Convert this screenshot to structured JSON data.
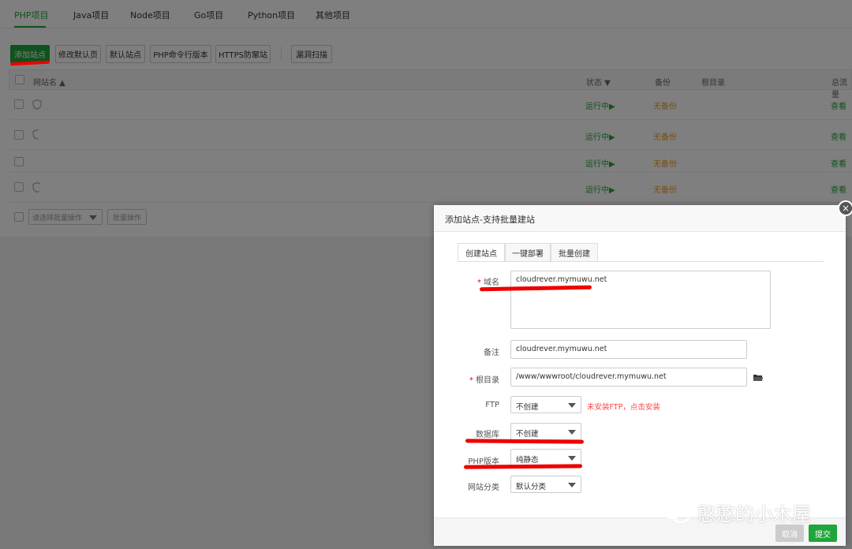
{
  "tabs": [
    "PHP项目",
    "Java项目",
    "Node项目",
    "Go项目",
    "Python项目",
    "其他项目"
  ],
  "toolbar": {
    "add_site": "添加站点",
    "modify_default_page": "修改默认页",
    "default_site": "默认站点",
    "php_cli_version": "PHP命令行版本",
    "https_protection": "HTTPS防窜站",
    "vuln_scan": "漏洞扫描"
  },
  "table": {
    "headers": {
      "site_name": "网站名",
      "status": "状态",
      "backup": "备份",
      "root": "根目录",
      "traffic": "总流量"
    },
    "rows": [
      {
        "status": "运行中▶",
        "backup": "无备份",
        "action": "查看"
      },
      {
        "status": "运行中▶",
        "backup": "无备份",
        "action": "查看"
      },
      {
        "status": "运行中▶",
        "backup": "无备份",
        "action": "查看"
      },
      {
        "status": "运行中▶",
        "backup": "无备份",
        "action": "查看"
      }
    ],
    "batch_placeholder": "请选择批量操作",
    "batch_button": "批量操作"
  },
  "dialog": {
    "title": "添加站点-支持批量建站",
    "close": "×",
    "tabs": [
      "创建站点",
      "一键部署",
      "批量创建"
    ],
    "labels": {
      "domain": "域名",
      "remark": "备注",
      "root": "根目录",
      "ftp": "FTP",
      "database": "数据库",
      "php_version": "PHP版本",
      "category": "网站分类"
    },
    "values": {
      "domain": "cloudrever.mymuwu.net",
      "remark": "cloudrever.mymuwu.net",
      "root": "/www/wwwroot/cloudrever.mymuwu.net",
      "ftp": "不创建",
      "database": "不创建",
      "php_version": "纯静态",
      "category": "默认分类"
    },
    "ftp_note": "未安装FTP，点击安装",
    "cancel": "取消",
    "submit": "提交"
  },
  "watermark": "憨憨的小木屋",
  "colors": {
    "accent": "#20a53a",
    "annotation": "#e00000",
    "warning": "#f39c12"
  }
}
